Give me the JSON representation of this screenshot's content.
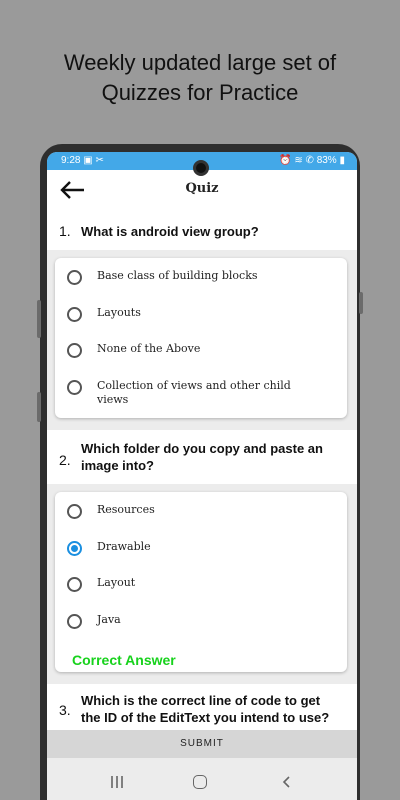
{
  "promo": {
    "line1": "Weekly updated large set of",
    "line2": "Quizzes for Practice"
  },
  "status_bar": {
    "time": "9:28",
    "left_icons": "▣ ✂",
    "right_icons": "⏰ ≋ ✆",
    "battery": "83%"
  },
  "app_bar": {
    "title": "Quiz",
    "back_icon": "arrow-left-icon"
  },
  "questions": [
    {
      "number": "1.",
      "text": "What is android view group?",
      "options": [
        {
          "label": "Base class of building blocks",
          "selected": false
        },
        {
          "label": "Layouts",
          "selected": false
        },
        {
          "label": "None of the Above",
          "selected": false
        },
        {
          "label": "Collection of views and other child views",
          "selected": false
        }
      ]
    },
    {
      "number": "2.",
      "text": "Which folder do you copy and paste an image into?",
      "options": [
        {
          "label": "Resources",
          "selected": false
        },
        {
          "label": "Drawable",
          "selected": true
        },
        {
          "label": "Layout",
          "selected": false
        },
        {
          "label": "Java",
          "selected": false
        }
      ],
      "feedback": "Correct Answer"
    },
    {
      "number": "3.",
      "text": "Which is the correct line of code to get the ID of the EditText you intend to use?"
    }
  ],
  "submit_label": "SUBMIT",
  "colors": {
    "status_bar": "#43a8e8",
    "radio_selected": "#1a8fe0",
    "correct_text": "#17d21c"
  }
}
